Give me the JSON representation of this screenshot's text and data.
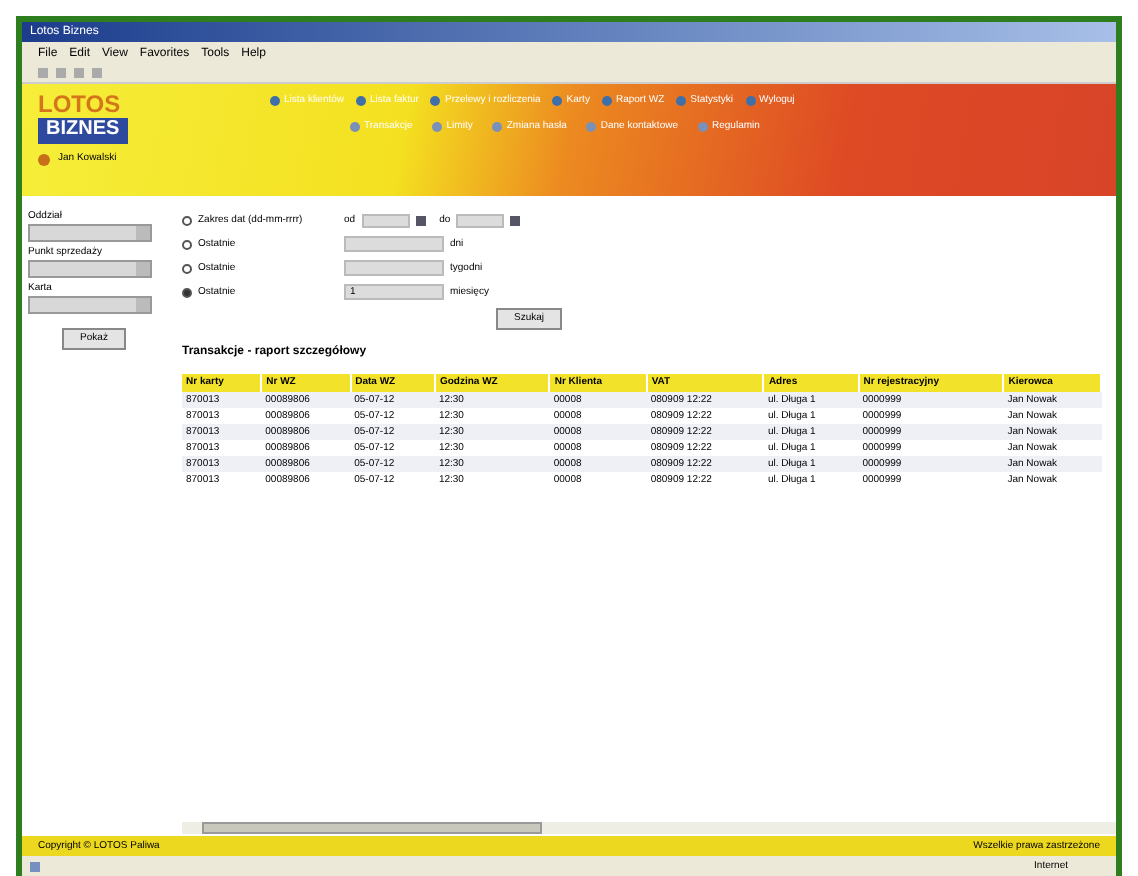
{
  "window": {
    "title": "Lotos Biznes"
  },
  "menu": [
    "File",
    "Edit",
    "View",
    "Favorites",
    "Tools",
    "Help"
  ],
  "logo": {
    "top": "LOTOS",
    "bottom": "BIZNES"
  },
  "user": "Jan Kowalski",
  "nav_top": [
    "Lista klientów",
    "Lista faktur",
    "Przelewy i rozliczenia",
    "Karty",
    "Raport WZ",
    "Statystyki",
    "Wyloguj"
  ],
  "nav_bottom": [
    "Transakcje",
    "Limity",
    "Zmiana hasła",
    "Dane kontaktowe",
    "Regulamin"
  ],
  "sidebar": {
    "filters": [
      {
        "label": "Oddział"
      },
      {
        "label": "Punkt sprzedaży"
      },
      {
        "label": "Karta"
      }
    ],
    "button": "Pokaż"
  },
  "form": {
    "rows": [
      {
        "kind": "range",
        "label": "Zakres dat (dd-mm-rrrr)",
        "from": "od",
        "to": "do",
        "selected": false
      },
      {
        "kind": "last",
        "label": "Ostatnie",
        "unit": "dni",
        "value": "",
        "selected": false
      },
      {
        "kind": "last",
        "label": "Ostatnie",
        "unit": "tygodni",
        "value": "",
        "selected": false
      },
      {
        "kind": "last",
        "label": "Ostatnie",
        "unit": "miesięcy",
        "value": "1",
        "selected": true
      }
    ],
    "button": "Szukaj"
  },
  "report_title": "Transakcje - raport szczegółowy",
  "table": {
    "columns": [
      "Nr karty",
      "Nr WZ",
      "Data WZ",
      "Godzina WZ",
      "Nr Klienta",
      "VAT",
      "Adres",
      "Nr rejestracyjny",
      "Kierowca"
    ],
    "rows": [
      [
        "870013",
        "00089806",
        "05-07-12",
        "12:30",
        "00008",
        "080909 12:22",
        "ul. Długa 1",
        "0000999",
        "Jan Nowak"
      ],
      [
        "870013",
        "00089806",
        "05-07-12",
        "12:30",
        "00008",
        "080909 12:22",
        "ul. Długa 1",
        "0000999",
        "Jan Nowak"
      ],
      [
        "870013",
        "00089806",
        "05-07-12",
        "12:30",
        "00008",
        "080909 12:22",
        "ul. Długa 1",
        "0000999",
        "Jan Nowak"
      ],
      [
        "870013",
        "00089806",
        "05-07-12",
        "12:30",
        "00008",
        "080909 12:22",
        "ul. Długa 1",
        "0000999",
        "Jan Nowak"
      ],
      [
        "870013",
        "00089806",
        "05-07-12",
        "12:30",
        "00008",
        "080909 12:22",
        "ul. Długa 1",
        "0000999",
        "Jan Nowak"
      ],
      [
        "870013",
        "00089806",
        "05-07-12",
        "12:30",
        "00008",
        "080909 12:22",
        "ul. Długa 1",
        "0000999",
        "Jan Nowak"
      ]
    ]
  },
  "footer": {
    "left": "Copyright © LOTOS Paliwa",
    "right": "Wszelkie prawa zastrzeżone"
  },
  "status_bar": {
    "zone": "Internet"
  }
}
